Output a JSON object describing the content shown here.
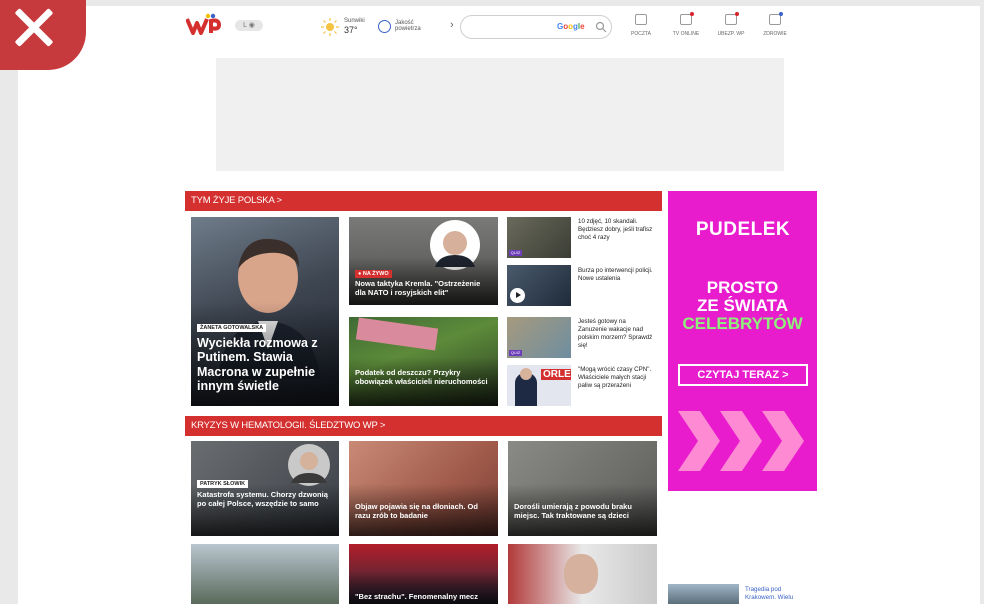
{
  "header": {
    "lang_toggle": "L ◉",
    "weather_label": "Sunwiki",
    "weather_temp": "37°",
    "air_label": "Jakość powietrza",
    "air_chevron": "›",
    "search_placeholder": "",
    "google_text": [
      "G",
      "o",
      "o",
      "g",
      "l",
      "e"
    ],
    "links": [
      {
        "label": "POCZTA"
      },
      {
        "label": "TV ONLINE"
      },
      {
        "label": "UBEZP. WP"
      },
      {
        "label": "ZDROWIE"
      }
    ]
  },
  "sections": {
    "section1_title": "TYM ŻYJE POLSKA >",
    "section2_title": "KRYZYS W HEMATOLOGII. ŚLEDZTWO WP >"
  },
  "main_tile": {
    "badge": "ŻANETA GOTOWALSKA",
    "title": "Wyciekła rozmowa z Putinem. Stawia Macrona w zupełnie innym świetle"
  },
  "mid_tiles": [
    {
      "live": "● NA ŻYWO",
      "title": "Nowa taktyka Kremla. \"Ostrzeżenie dla NATO i rosyjskich elit\""
    },
    {
      "title": "Podatek od deszczu? Przykry obowiązek właścicieli nieruchomości"
    }
  ],
  "side_items": [
    {
      "text": "10 zdjęć, 10 skandali. Będziesz dobry, jeśli trafisz choć 4 razy",
      "label": "QUIZ"
    },
    {
      "text": "Burza po interwencji policji. Nowe ustalenia"
    },
    {
      "text": "Jesteś gotowy na Zanuzenie wakacje nad polskim morzem? Sprawdź się!",
      "label": "QUIZ"
    },
    {
      "text": "\"Mogą wrócić czasy CPN\". Właściciele małych stacji paliw są przerażeni",
      "logo": "ORLEN"
    }
  ],
  "row2": [
    {
      "badge": "PATRYK SŁOWIK",
      "title": "Katastrofa systemu. Chorzy dzwonią po całej Polsce, wszędzie to samo"
    },
    {
      "title": "Objaw pojawia się na dłoniach. Od razu zrób to badanie"
    },
    {
      "title": "Dorośli umierają z powodu braku miejsc. Tak traktowane są dzieci"
    }
  ],
  "row3": [
    {
      "title": ""
    },
    {
      "title": "\"Bez strachu\". Fenomenalny mecz"
    },
    {
      "title": ""
    }
  ],
  "bottom_side": {
    "text": "Tragedia pod Krakowem. Wielu"
  },
  "pudelek_ad": {
    "logo": "PUDELEK",
    "line1": "PROSTO",
    "line2": "ZE ŚWIATA",
    "line3": "CELEBRYTÓW",
    "button": "CZYTAJ TERAZ >"
  },
  "colors": {
    "accent_red": "#d4302f",
    "pudelek_pink": "#e81ccd",
    "pudelek_green": "#8ef07a"
  }
}
